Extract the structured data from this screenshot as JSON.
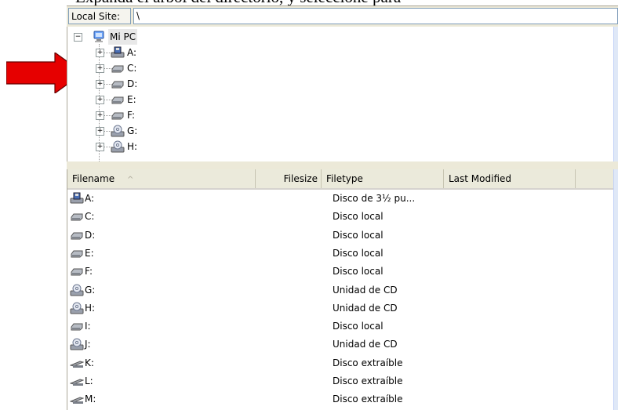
{
  "top_text": "Expanda el árbol del directorio, y seleccione para",
  "local_site": {
    "label": "Local Site:",
    "value": "\\"
  },
  "tree": {
    "root": {
      "label": "Mi PC",
      "icon": "my-computer-icon"
    },
    "items": [
      {
        "label": "A:",
        "icon": "floppy-drive-icon"
      },
      {
        "label": "C:",
        "icon": "hard-disk-icon"
      },
      {
        "label": "D:",
        "icon": "hard-disk-icon"
      },
      {
        "label": "E:",
        "icon": "hard-disk-icon"
      },
      {
        "label": "F:",
        "icon": "hard-disk-icon"
      },
      {
        "label": "G:",
        "icon": "cd-drive-icon"
      },
      {
        "label": "H:",
        "icon": "cd-drive-icon"
      }
    ]
  },
  "list": {
    "columns": [
      "Filename",
      "Filesize",
      "Filetype",
      "Last Modified"
    ],
    "sort_indicator": "^",
    "rows": [
      {
        "name": "A:",
        "type": "Disco de 3½ pu...",
        "icon": "floppy-drive-icon"
      },
      {
        "name": "C:",
        "type": "Disco local",
        "icon": "hard-disk-icon"
      },
      {
        "name": "D:",
        "type": "Disco local",
        "icon": "hard-disk-icon"
      },
      {
        "name": "E:",
        "type": "Disco local",
        "icon": "hard-disk-icon"
      },
      {
        "name": "F:",
        "type": "Disco local",
        "icon": "hard-disk-icon"
      },
      {
        "name": "G:",
        "type": "Unidad de CD",
        "icon": "cd-drive-icon"
      },
      {
        "name": "H:",
        "type": "Unidad de CD",
        "icon": "cd-drive-icon"
      },
      {
        "name": "I:",
        "type": "Disco local",
        "icon": "hard-disk-icon"
      },
      {
        "name": "J:",
        "type": "Unidad de CD",
        "icon": "cd-drive-icon"
      },
      {
        "name": "K:",
        "type": "Disco extraíble",
        "icon": "removable-disk-icon"
      },
      {
        "name": "L:",
        "type": "Disco extraíble",
        "icon": "removable-disk-icon"
      },
      {
        "name": "M:",
        "type": "Disco extraíble",
        "icon": "removable-disk-icon"
      }
    ]
  },
  "colors": {
    "arrow": "#e60000",
    "header_bg": "#ebeadb",
    "border": "#7f9db9"
  }
}
